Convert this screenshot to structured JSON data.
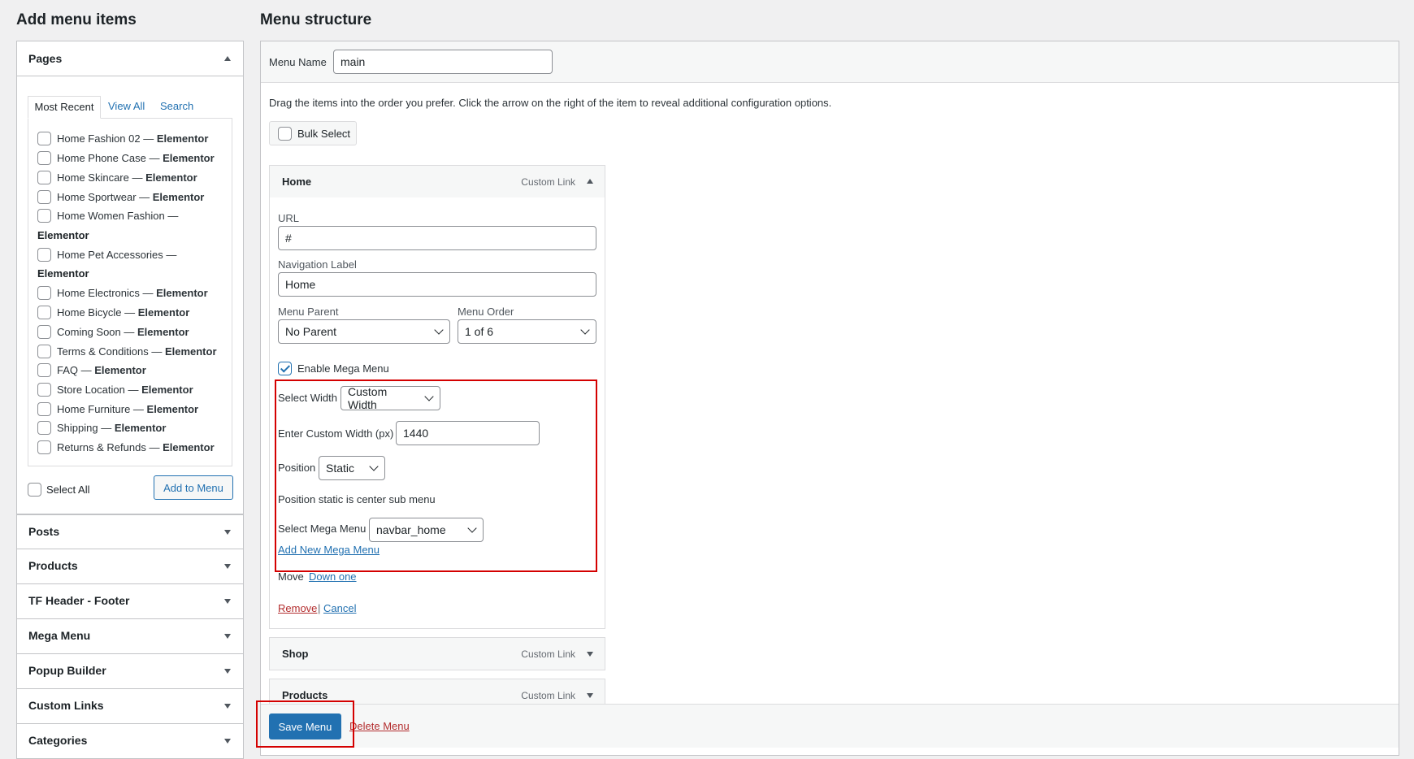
{
  "left_title": "Add menu items",
  "right_title": "Menu structure",
  "pages_panel": {
    "title": "Pages",
    "tabs": [
      "Most Recent",
      "View All",
      "Search"
    ],
    "items": [
      {
        "name": "Home Fashion 02 — ",
        "builder": "Elementor"
      },
      {
        "name": "Home Phone Case — ",
        "builder": "Elementor"
      },
      {
        "name": "Home Skincare — ",
        "builder": "Elementor"
      },
      {
        "name": "Home Sportwear — ",
        "builder": "Elementor"
      },
      {
        "name": "Home Women Fashion — ",
        "builder": "Elementor"
      },
      {
        "name": "Home Pet Accessories — ",
        "builder": "Elementor"
      },
      {
        "name": "Home Electronics — ",
        "builder": "Elementor"
      },
      {
        "name": "Home Bicycle — ",
        "builder": "Elementor"
      },
      {
        "name": "Coming Soon — ",
        "builder": "Elementor"
      },
      {
        "name": "Terms & Conditions — ",
        "builder": "Elementor"
      },
      {
        "name": "FAQ — ",
        "builder": "Elementor"
      },
      {
        "name": "Store Location — ",
        "builder": "Elementor"
      },
      {
        "name": "Home Furniture — ",
        "builder": "Elementor"
      },
      {
        "name": "Shipping — ",
        "builder": "Elementor"
      },
      {
        "name": "Returns & Refunds — ",
        "builder": "Elementor"
      }
    ],
    "select_all": "Select All",
    "add_button": "Add to Menu"
  },
  "other_panels": [
    "Posts",
    "Products",
    "TF Header - Footer",
    "Mega Menu",
    "Popup Builder",
    "Custom Links",
    "Categories"
  ],
  "menu_name_label": "Menu Name",
  "menu_name_value": "main",
  "instructions": "Drag the items into the order you prefer. Click the arrow on the right of the item to reveal additional configuration options.",
  "bulk_select": "Bulk Select",
  "home_item": {
    "title": "Home",
    "type": "Custom Link",
    "url_label": "URL",
    "url_value": "#",
    "nav_label": "Navigation Label",
    "nav_value": "Home",
    "parent_label": "Menu Parent",
    "parent_value": "No Parent",
    "order_label": "Menu Order",
    "order_value": "1 of 6",
    "mega_enable": "Enable Mega Menu",
    "width_label": "Select Width",
    "width_value": "Custom Width",
    "custom_width_label": "Enter Custom Width (px)",
    "custom_width_value": "1440",
    "position_label": "Position",
    "position_value": "Static",
    "position_note": "Position static is center sub menu",
    "mega_select_label": "Select Mega Menu",
    "mega_select_value": "navbar_home",
    "add_mega": "Add New Mega Menu",
    "move_label": "Move",
    "move_link": "Down one",
    "remove": "Remove",
    "separator": "|",
    "cancel": "Cancel"
  },
  "other_items": [
    {
      "title": "Shop",
      "type": "Custom Link"
    },
    {
      "title": "Products",
      "type": "Custom Link"
    }
  ],
  "save_button": "Save Menu",
  "delete_link": "Delete Menu",
  "colors": {
    "accent": "#2271b1",
    "highlight": "#d40000",
    "danger": "#b32d2e"
  }
}
